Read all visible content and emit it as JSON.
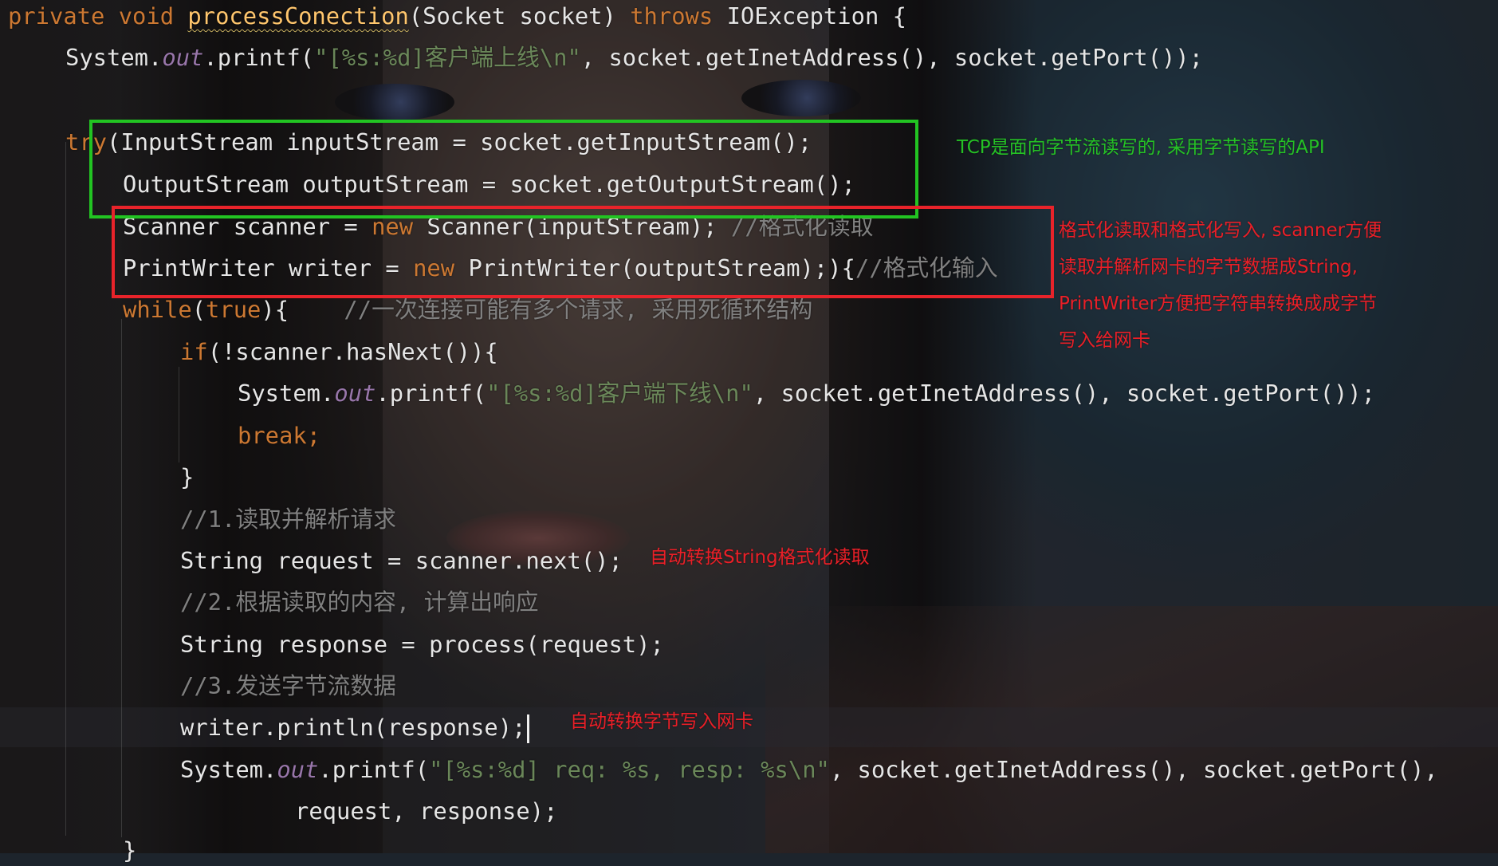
{
  "code": {
    "l1": {
      "kw1": "private void ",
      "name": "processConection",
      "rest": "(Socket socket) ",
      "kw2": "throws",
      "rest2": " IOException {"
    },
    "l2": {
      "a": "System.",
      "b": "out",
      "c": ".printf(",
      "s": "\"[%s:%d]客户端上线\\n\"",
      "d": ", socket.getInetAddress(), socket.getPort());"
    },
    "l3": {
      "kw": "try",
      "a": "(InputStream inputStream = socket.getInputStream();"
    },
    "l4": {
      "a": "OutputStream outputStream = socket.getOutputStream();"
    },
    "l5": {
      "a": "Scanner scanner = ",
      "kw": "new",
      "b": " Scanner(inputStream); ",
      "c": "//格式化读取"
    },
    "l6": {
      "a": "PrintWriter writer = ",
      "kw": "new",
      "b": " PrintWriter(outputStream);){",
      "c": "//格式化输入"
    },
    "l7": {
      "kw": "while",
      "a": "(",
      "kw2": "true",
      "b": "){    ",
      "c": "//一次连接可能有多个请求, 采用死循环结构"
    },
    "l8": {
      "kw": "if",
      "a": "(!scanner.hasNext()){"
    },
    "l9": {
      "a": "System.",
      "b": "out",
      "c": ".printf(",
      "s": "\"[%s:%d]客户端下线\\n\"",
      "d": ", socket.getInetAddress(), socket.getPort());"
    },
    "l10": {
      "kw": "break",
      "a": ";"
    },
    "l11": {
      "a": "}"
    },
    "l12": {
      "c": "//1.读取并解析请求"
    },
    "l13": {
      "a": "String request = scanner.next();"
    },
    "l14": {
      "c": "//2.根据读取的内容, 计算出响应"
    },
    "l15": {
      "a": "String response = process(request);"
    },
    "l16": {
      "c": "//3.发送字节流数据"
    },
    "l17": {
      "a": "writer.println(response);"
    },
    "l18": {
      "a": "System.",
      "b": "out",
      "c": ".printf(",
      "s": "\"[%s:%d] req: %s, resp: %s\\n\"",
      "d": ", socket.getInetAddress(), socket.getPort(),"
    },
    "l19": {
      "a": "request, response);"
    },
    "l20": {
      "a": "}"
    }
  },
  "annotations": {
    "green": "TCP是面向字节流读写的, 采用字节读写的API",
    "red_block": [
      "格式化读取和格式化写入, scanner方便",
      "读取并解析网卡的字节数据成String,",
      "PrintWriter方便把字符串转换成成字节",
      "写入给网卡"
    ],
    "scanner_note": "自动转换String格式化读取",
    "writer_note": "自动转换字节写入网卡"
  },
  "colors": {
    "keyword": "#cc7832",
    "string": "#6a8759",
    "method_decl": "#ffc66d",
    "static_field": "#9876aa",
    "comment": "#808080",
    "box_green": "#22c422",
    "box_red": "#e8232a"
  }
}
